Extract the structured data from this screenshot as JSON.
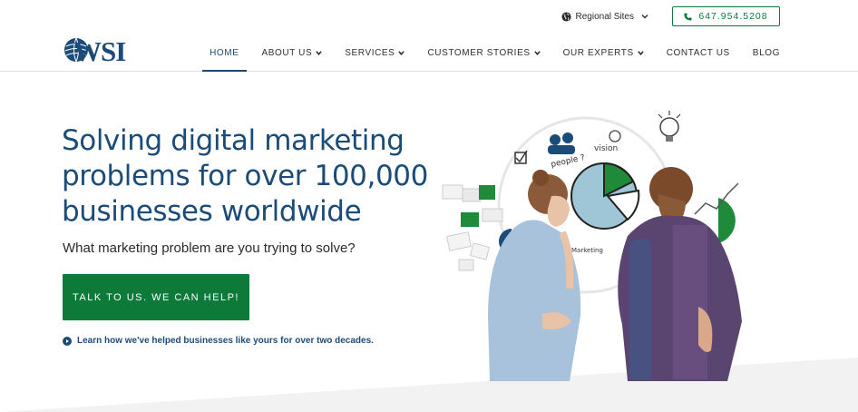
{
  "util": {
    "regional_label": "Regional Sites",
    "phone": "647.954.5208"
  },
  "nav": {
    "home": "HOME",
    "about": "ABOUT US",
    "services": "SERVICES",
    "customer_stories": "CUSTOMER STORIES",
    "experts": "OUR EXPERTS",
    "contact": "CONTACT US",
    "blog": "BLOG"
  },
  "logo": {
    "text": "WSI"
  },
  "hero": {
    "headline": "Solving digital marketing problems for over 100,000 businesses worldwide",
    "subheadline": "What marketing problem are you trying to solve?",
    "cta_label": "TALK TO US. WE CAN HELP!",
    "learn_link": "Learn how we've helped businesses like yours for over two decades."
  },
  "illustration": {
    "sketch_words": [
      "people ?",
      "vision",
      "Marketing"
    ]
  },
  "colors": {
    "brand_blue": "#1b4c79",
    "brand_green": "#0d7a3a"
  },
  "icons": [
    "globe-icon",
    "chevron-down-icon",
    "phone-icon",
    "caret-down-icon",
    "play-circle-icon"
  ]
}
